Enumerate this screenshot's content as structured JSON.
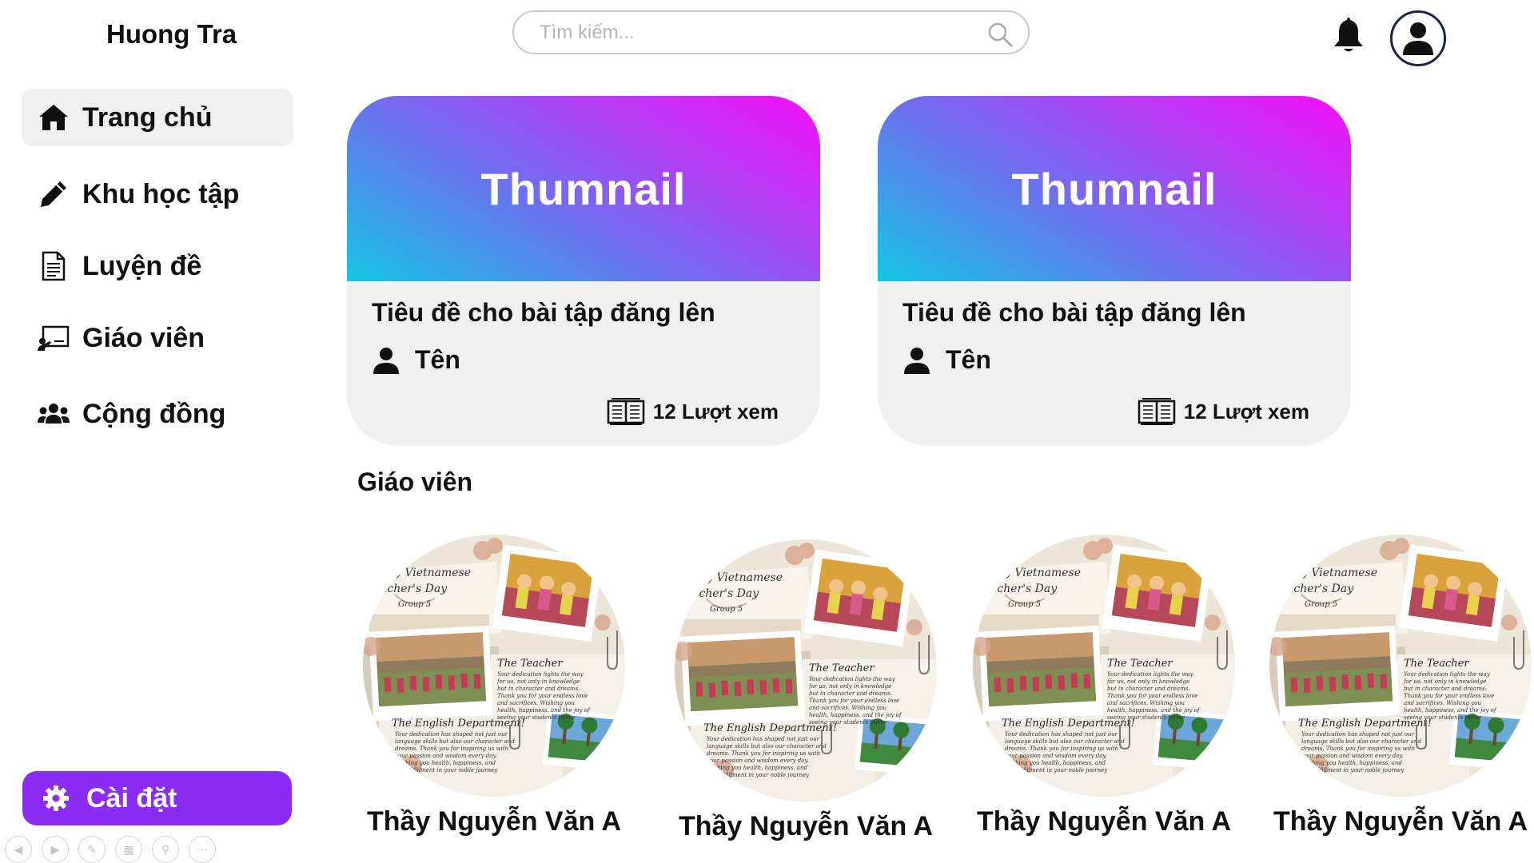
{
  "app": {
    "brand": "Huong Tra"
  },
  "sidebar": {
    "items": [
      {
        "label": "Trang chủ",
        "icon": "home-icon",
        "active": true
      },
      {
        "label": "Khu học tập",
        "icon": "pencil-icon",
        "active": false
      },
      {
        "label": "Luyện đề",
        "icon": "document-icon",
        "active": false
      },
      {
        "label": "Giáo viên",
        "icon": "teacher-board-icon",
        "active": false
      },
      {
        "label": "Cộng đồng",
        "icon": "community-icon",
        "active": false
      }
    ],
    "settings_label": "Cài đặt",
    "settings_icon": "gear-icon"
  },
  "header": {
    "search_placeholder": "Tìm kiếm...",
    "search_icon": "search-icon",
    "notification_icon": "bell-icon",
    "profile_icon": "user-avatar-icon"
  },
  "cards": [
    {
      "thumbnail_text": "Thumnail",
      "title": "Tiêu đề cho bài tập đăng lên",
      "author": "Tên",
      "views": "12 Lượt xem"
    },
    {
      "thumbnail_text": "Thumnail",
      "title": "Tiêu đề cho bài tập đăng lên",
      "author": "Tên",
      "views": "12 Lượt xem"
    }
  ],
  "teachers_section": {
    "title": "Giáo viên",
    "teachers": [
      {
        "name": "Thầy Nguyễn Văn A"
      },
      {
        "name": "Thầy Nguyễn Văn A"
      },
      {
        "name": "Thầy Nguyễn Văn A"
      },
      {
        "name": "Thầy Nguyễn Văn A"
      }
    ],
    "photo_text": {
      "header_1": "y Vietnamese",
      "header_2": "acher's Day",
      "group": "Group 5",
      "teacher_heading": "The Teacher",
      "teacher_body": [
        "Your dedication lights the way",
        "for us, not only in knowledge",
        "but in character and dreams.",
        "Thank you for your endless love",
        "and sacrifices. Wishing you",
        "health, happiness, and the joy of",
        "seeing your students thrive"
      ],
      "dept_heading": "The English Department!",
      "dept_body": [
        "Your dedication has shaped not just our",
        "language skills but also our character and",
        "dreams. Thank you for inspiring us with",
        "your passion and wisdom every day.",
        "Wishing you health, happiness, and",
        "ess fulfillment in your noble journey"
      ]
    }
  },
  "colors": {
    "accent": "#8b2cf6",
    "gradient_start": "#14c7e3",
    "gradient_end": "#f40ef8",
    "card_bg": "#f0f0f0"
  },
  "slide_controls": [
    "prev-icon",
    "next-icon",
    "pen-icon",
    "grid-icon",
    "zoom-icon",
    "more-icon"
  ]
}
